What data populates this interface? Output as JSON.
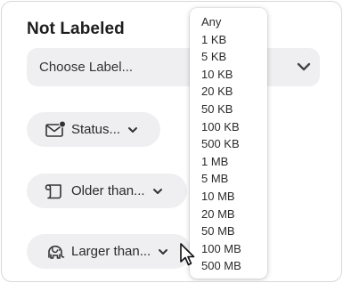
{
  "section": {
    "title": "Not Labeled"
  },
  "label_select": {
    "value": "Choose Label...",
    "icon": "chevron-down-icon"
  },
  "filters": [
    {
      "label": "Status...",
      "icon": "envelope-badge-icon"
    },
    {
      "label": "Older than...",
      "icon": "scroll-icon"
    },
    {
      "label": "Larger than...",
      "icon": "elephant-icon"
    }
  ],
  "size_menu": {
    "items": [
      "Any",
      "1 KB",
      "5 KB",
      "10 KB",
      "20 KB",
      "50 KB",
      "100 KB",
      "500 KB",
      "1 MB",
      "5 MB",
      "10 MB",
      "20 MB",
      "50 MB",
      "100 MB",
      "500 MB"
    ]
  },
  "colors": {
    "control_bg": "#efeff1",
    "menu_bg": "#ffffff"
  }
}
